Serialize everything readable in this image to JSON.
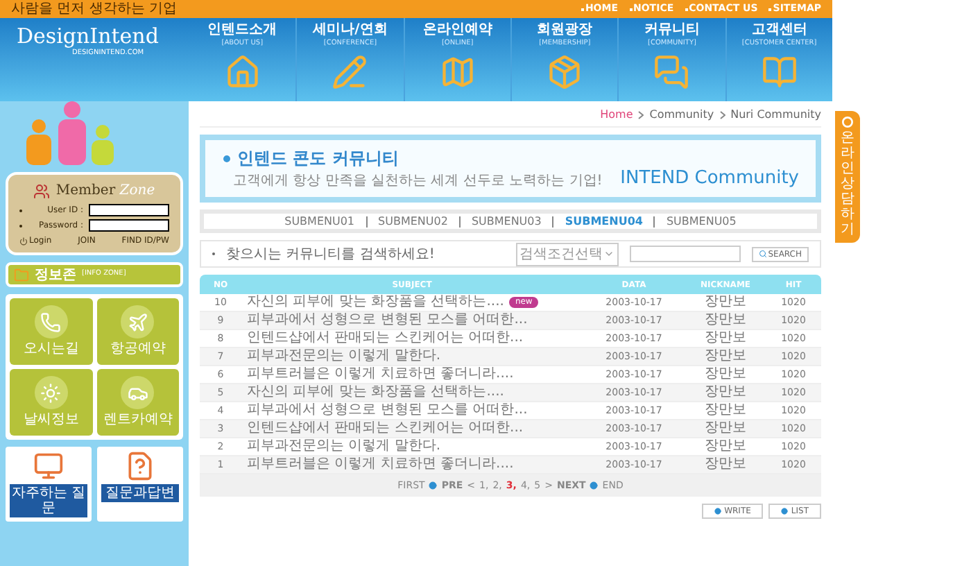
{
  "top_bar": {
    "tagline": "사람을 먼저 생각하는 기업",
    "links": [
      "HOME",
      "NOTICE",
      "CONTACT US",
      "SITEMAP"
    ]
  },
  "logo": {
    "text": "DesignIntend",
    "url": "DESIGNINTEND.COM"
  },
  "nav": [
    {
      "label": "인텐드소개",
      "sub": "[ABOUT US]"
    },
    {
      "label": "세미나/연회",
      "sub": "[CONFERENCE]"
    },
    {
      "label": "온라인예약",
      "sub": "[ONLINE]"
    },
    {
      "label": "회원광장",
      "sub": "[MEMBERSHIP]"
    },
    {
      "label": "커뮤니티",
      "sub": "[COMMUNITY]"
    },
    {
      "label": "고객센터",
      "sub": "[CUSTOMER CENTER]"
    }
  ],
  "member_zone": {
    "title_a": "Member",
    "title_b": "Zone",
    "fields": [
      {
        "label": "User ID :"
      },
      {
        "label": "Password :"
      }
    ],
    "links": [
      "Login",
      "JOIN",
      "FIND ID/PW"
    ]
  },
  "info_zone": {
    "label": "정보존",
    "sub": "[INFO ZONE]"
  },
  "quick_tiles": [
    "오시는길",
    "항공예약",
    "날씨정보",
    "렌트카예약"
  ],
  "help_tiles": [
    "자주하는 질문",
    "질문과답변"
  ],
  "breadcrumb": [
    "Home",
    "Community",
    "Nuri Community"
  ],
  "banner": {
    "title": "인텐드 콘도 커뮤니티",
    "subtitle": "고객에게 항상 만족을 실천하는 세계 선두로 노력하는 기업!",
    "brand": "INTEND Community"
  },
  "submenu": [
    {
      "label": "SUBMENU01",
      "selected": false
    },
    {
      "label": "SUBMENU02",
      "selected": false
    },
    {
      "label": "SUBMENU03",
      "selected": false
    },
    {
      "label": "SUBMENU04",
      "selected": true
    },
    {
      "label": "SUBMENU05",
      "selected": false
    }
  ],
  "search": {
    "prompt": "찾으시는 커뮤니티를 검색하세요!",
    "select": "검색조건선택",
    "button": "SEARCH"
  },
  "table": {
    "columns": [
      "NO",
      "SUBJECT",
      "DATA",
      "NICKNAME",
      "HIT"
    ],
    "rows": [
      {
        "no": "10",
        "subject": "자신의 피부에 맞는 화장품을 선택하는....",
        "badge": "new",
        "date": "2003-10-17",
        "nickname": "장만보",
        "hit": "1020"
      },
      {
        "no": "9",
        "subject": "피부과에서 성형으로 변형된 모스를 어떠한...",
        "date": "2003-10-17",
        "nickname": "장만보",
        "hit": "1020"
      },
      {
        "no": "8",
        "subject": "인텐드샵에서 판매되는 스킨케어는 어떠한...",
        "date": "2003-10-17",
        "nickname": "장만보",
        "hit": "1020"
      },
      {
        "no": "7",
        "subject": "피부과전문의는 이렇게 말한다.",
        "date": "2003-10-17",
        "nickname": "장만보",
        "hit": "1020"
      },
      {
        "no": "6",
        "subject": "피부트러블은 이렇게 치료하면 좋더니라....",
        "date": "2003-10-17",
        "nickname": "장만보",
        "hit": "1020"
      },
      {
        "no": "5",
        "subject": "자신의 피부에 맞는 화장품을 선택하는....",
        "date": "2003-10-17",
        "nickname": "장만보",
        "hit": "1020"
      },
      {
        "no": "4",
        "subject": "피부과에서 성형으로 변형된 모스를 어떠한...",
        "date": "2003-10-17",
        "nickname": "장만보",
        "hit": "1020"
      },
      {
        "no": "3",
        "subject": "인텐드샵에서 판매되는 스킨케어는 어떠한...",
        "date": "2003-10-17",
        "nickname": "장만보",
        "hit": "1020"
      },
      {
        "no": "2",
        "subject": "피부과전문의는 이렇게 말한다.",
        "date": "2003-10-17",
        "nickname": "장만보",
        "hit": "1020"
      },
      {
        "no": "1",
        "subject": "피부트러블은 이렇게 치료하면 좋더니라....",
        "date": "2003-10-17",
        "nickname": "장만보",
        "hit": "1020"
      }
    ]
  },
  "pagination": {
    "first": "FIRST",
    "prev": "PRE",
    "open": "<",
    "pages": [
      {
        "label": "1,",
        "selected": false
      },
      {
        "label": "2,",
        "selected": false
      },
      {
        "label": "3,",
        "selected": true
      },
      {
        "label": "4,",
        "selected": false
      },
      {
        "label": "5",
        "selected": false
      }
    ],
    "close": ">",
    "next": "NEXT",
    "end": "END"
  },
  "actions": [
    "WRITE",
    "LIST"
  ],
  "side_tab": {
    "label": "온라인상담하기"
  }
}
